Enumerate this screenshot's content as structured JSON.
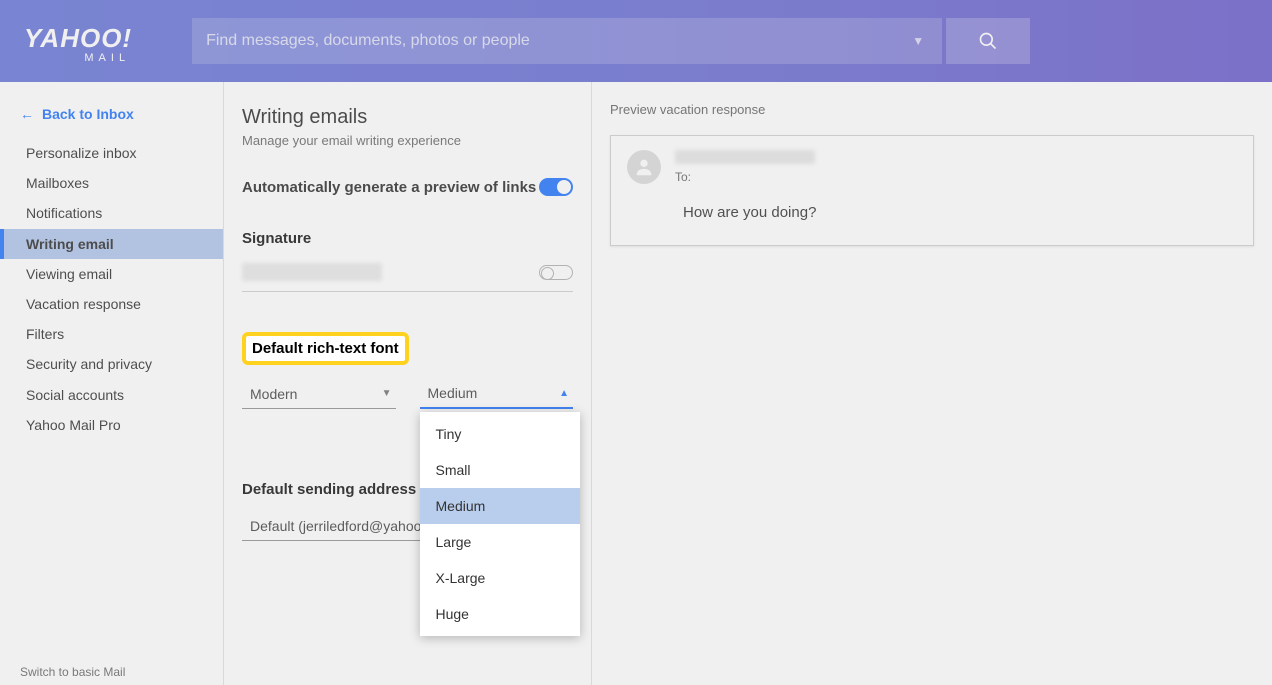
{
  "header": {
    "logo_main": "YAHOO!",
    "logo_sub": "MAIL",
    "search_placeholder": "Find messages, documents, photos or people"
  },
  "sidebar": {
    "back_label": "Back to Inbox",
    "items": [
      {
        "label": "Personalize inbox",
        "selected": false
      },
      {
        "label": "Mailboxes",
        "selected": false
      },
      {
        "label": "Notifications",
        "selected": false
      },
      {
        "label": "Writing email",
        "selected": true
      },
      {
        "label": "Viewing email",
        "selected": false
      },
      {
        "label": "Vacation response",
        "selected": false
      },
      {
        "label": "Filters",
        "selected": false
      },
      {
        "label": "Security and privacy",
        "selected": false
      },
      {
        "label": "Social accounts",
        "selected": false
      },
      {
        "label": "Yahoo Mail Pro",
        "selected": false
      }
    ],
    "switch_basic": "Switch to basic Mail"
  },
  "settings": {
    "title": "Writing emails",
    "subtitle": "Manage your email writing experience",
    "auto_preview_label": "Automatically generate a preview of links",
    "auto_preview_on": true,
    "signature_label": "Signature",
    "signature_on": false,
    "richtext_label": "Default rich-text font",
    "font_family_value": "Modern",
    "font_size_value": "Medium",
    "font_size_options": [
      "Tiny",
      "Small",
      "Medium",
      "Large",
      "X-Large",
      "Huge"
    ],
    "sending_label": "Default sending address",
    "sending_value": "Default (jerriledford@yahoo.c"
  },
  "preview": {
    "title": "Preview vacation response",
    "to_label": "To:",
    "body": "How are you doing?"
  }
}
